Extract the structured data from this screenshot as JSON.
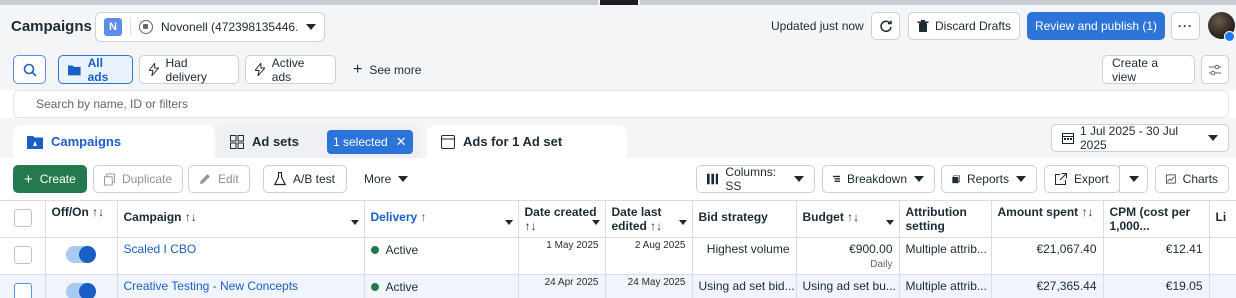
{
  "app": {
    "title": "Campaigns"
  },
  "account": {
    "initial": "N",
    "name": "Novonell (472398135446..."
  },
  "header": {
    "updated": "Updated just now",
    "discard": "Discard Drafts",
    "review": "Review and publish (1)",
    "more": "···"
  },
  "filters": {
    "all_ads": "All ads",
    "had_delivery": "Had delivery",
    "active_ads": "Active ads",
    "see_more": "See more",
    "create_view": "Create a view"
  },
  "search": {
    "placeholder": "Search by name, ID or filters"
  },
  "tabs": {
    "campaigns": "Campaigns",
    "ad_sets": "Ad sets",
    "selected": "1 selected",
    "ads": "Ads for 1 Ad set"
  },
  "date_range": "1 Jul 2025 - 30 Jul 2025",
  "actions": {
    "create": "Create",
    "duplicate": "Duplicate",
    "edit": "Edit",
    "ab_test": "A/B test",
    "more": "More",
    "columns": "Columns: SS",
    "breakdown": "Breakdown",
    "reports": "Reports",
    "export": "Export",
    "charts": "Charts"
  },
  "table": {
    "headers": {
      "off_on": "Off/On ↑↓",
      "campaign": "Campaign ↑↓",
      "delivery": "Delivery ↑",
      "date_created": "Date created ↑↓",
      "date_last_edited": "Date last edited ↑↓",
      "bid_strategy": "Bid strategy",
      "budget": "Budget ↑↓",
      "attribution": "Attribution setting",
      "amount_spent": "Amount spent ↑↓",
      "cpm": "CPM (cost per 1,000...",
      "extra": "Li"
    },
    "rows": [
      {
        "campaign": "Scaled I CBO",
        "delivery": "Active",
        "date_created": "1 May 2025",
        "date_last_edited": "2 Aug 2025",
        "bid_strategy": "Highest volume",
        "budget": "€900.00",
        "budget_sub": "Daily",
        "attribution": "Multiple attrib...",
        "amount_spent": "€21,067.40",
        "cpm": "€12.41"
      },
      {
        "campaign": "Creative Testing - New Concepts",
        "delivery": "Active",
        "date_created": "24 Apr 2025",
        "date_last_edited": "24 May 2025",
        "bid_strategy": "Using ad set bid...",
        "budget": "Using ad set bu...",
        "budget_sub": "",
        "attribution": "Multiple attrib...",
        "amount_spent": "€27,365.44",
        "cpm": "€19.05"
      }
    ]
  },
  "colors": {
    "primary": "#2d74d8",
    "create_green": "#247a4e",
    "link": "#1a5fc4"
  }
}
